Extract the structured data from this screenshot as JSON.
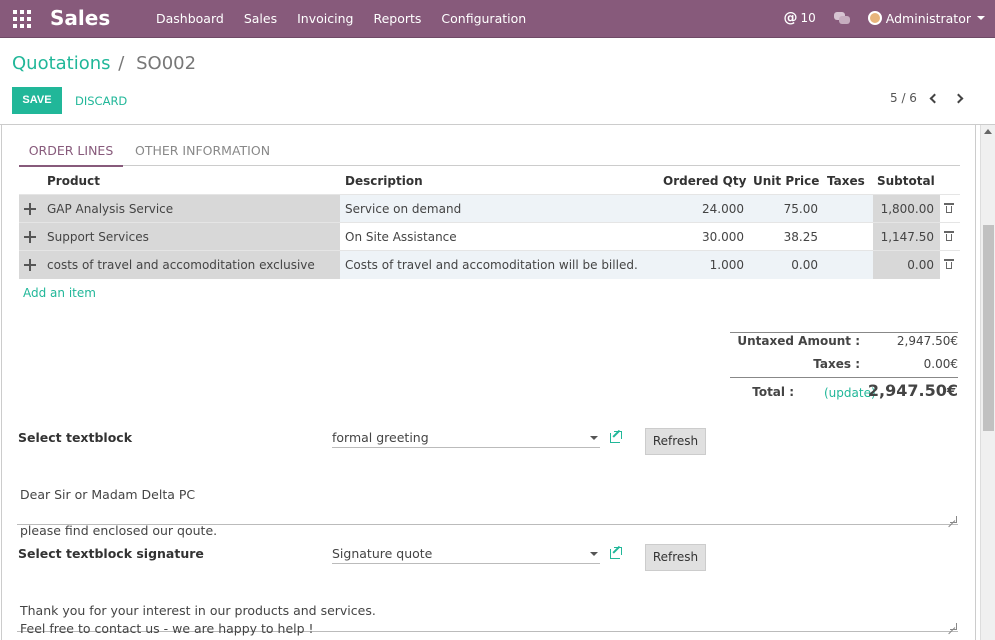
{
  "navbar": {
    "brand": "Sales",
    "menu": [
      "Dashboard",
      "Sales",
      "Invoicing",
      "Reports",
      "Configuration"
    ],
    "message_count": "10",
    "user": "Administrator",
    "color": "#875a7b"
  },
  "breadcrumb": {
    "parent": "Quotations",
    "separator": "/",
    "current": "SO002"
  },
  "actions": {
    "save": "SAVE",
    "discard": "DISCARD"
  },
  "pager": {
    "value": "5 / 6"
  },
  "tabs": [
    "ORDER LINES",
    "OTHER INFORMATION"
  ],
  "table": {
    "columns": [
      "Product",
      "Description",
      "Ordered Qty",
      "Unit Price",
      "Taxes",
      "Subtotal"
    ],
    "rows": [
      {
        "product": "GAP Analysis Service",
        "description": "Service on demand",
        "qty": "24.000",
        "price": "75.00",
        "taxes": "",
        "subtotal": "1,800.00"
      },
      {
        "product": "Support Services",
        "description": "On Site Assistance",
        "qty": "30.000",
        "price": "38.25",
        "taxes": "",
        "subtotal": "1,147.50"
      },
      {
        "product": "costs of travel and accomoditation exclusive",
        "description": "Costs of travel and accomoditation will be billed.",
        "qty": "1.000",
        "price": "0.00",
        "taxes": "",
        "subtotal": "0.00"
      }
    ],
    "add_item": "Add an item"
  },
  "totals": {
    "untaxed_label": "Untaxed Amount :",
    "untaxed_value": "2,947.50€",
    "taxes_label": "Taxes :",
    "taxes_value": "0.00€",
    "total_label": "Total :",
    "update": "(update)",
    "total_value": "2,947.50€"
  },
  "textblock": {
    "label": "Select textblock",
    "selected": "formal greeting",
    "refresh": "Refresh",
    "text": "Dear Sir or Madam Delta PC\n\nplease find enclosed our qoute."
  },
  "signature": {
    "label": "Select textblock signature",
    "selected": "Signature quote",
    "refresh": "Refresh",
    "text": "Thank you for your interest in our products and services.\nFeel free to contact us - we are happy to help !"
  }
}
